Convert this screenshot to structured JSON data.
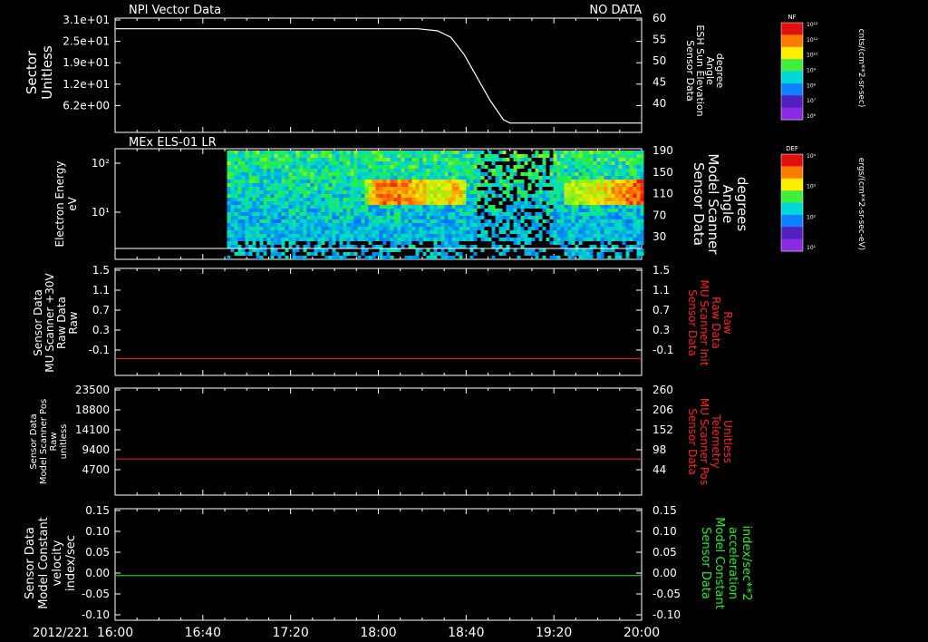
{
  "date_label": "2012/221",
  "time_ticks": [
    "16:00",
    "16:40",
    "17:20",
    "18:00",
    "18:40",
    "19:20",
    "20:00"
  ],
  "colors": {
    "background": "#000000",
    "foreground": "#ffffff",
    "red": "#ff2020",
    "green": "#22ee22"
  },
  "chart_data": [
    {
      "type": "line",
      "title": "NPI Vector Data",
      "status": "NO DATA",
      "ylabel_left": [
        "Sector",
        "Unitless"
      ],
      "yticks_left": [
        "3.1e+01",
        "2.5e+01",
        "1.9e+01",
        "1.2e+01",
        "6.2e+00"
      ],
      "ylabel_right": [
        "Sensor Data",
        "ESH Sun Elevation",
        "Angle",
        "degree"
      ],
      "yticks_right": [
        "60",
        "55",
        "50",
        "45",
        "40"
      ],
      "ylim_right": [
        33,
        60
      ],
      "series": [
        {
          "axis": "right",
          "color": "white",
          "x": [
            16.0,
            18.3,
            18.45,
            18.55,
            18.65,
            18.75,
            18.85,
            18.95,
            19.0,
            20.0
          ],
          "y": [
            57.5,
            57.5,
            57.0,
            55.5,
            51.5,
            46.0,
            40.5,
            36.0,
            35.2,
            35.2
          ]
        }
      ],
      "colorbar": {
        "label": "NF",
        "unit": "cnts/(cm**2-sr-sec)",
        "ticks": [
          "10¹²",
          "10¹¹",
          "10¹⁰",
          "10⁹",
          "10⁸",
          "10⁷",
          "10⁶"
        ]
      }
    },
    {
      "type": "heatmap",
      "title": "MEx ELS-01 LR",
      "ylabel_left": [
        "Electron Energy",
        "eV"
      ],
      "yticks_left": [
        "10²",
        "10¹"
      ],
      "ylabel_right": [
        "Sensor Data",
        "Model Scanner",
        "Angle",
        "degrees"
      ],
      "yticks_right": [
        "190",
        "150",
        "110",
        "70",
        "30"
      ],
      "x_range": [
        16.0,
        20.0
      ],
      "data_start": 16.85,
      "intensity_profile": [
        {
          "x": 16.85,
          "level": 0.45
        },
        {
          "x": 17.8,
          "level": 0.5
        },
        {
          "x": 18.0,
          "level": 0.95
        },
        {
          "x": 18.2,
          "level": 0.9
        },
        {
          "x": 18.4,
          "level": 0.75
        },
        {
          "x": 18.6,
          "level": 0.85
        },
        {
          "x": 18.75,
          "level": 0.3
        },
        {
          "x": 19.3,
          "level": 0.35
        },
        {
          "x": 19.4,
          "level": 0.7
        },
        {
          "x": 19.7,
          "level": 0.8
        },
        {
          "x": 20.0,
          "level": 1.0
        }
      ],
      "colorbar": {
        "label": "DEF",
        "unit": "ergs/(cm**2-sr-sec-eV)",
        "ticks": [
          "10⁴",
          "10³",
          "10²",
          "10¹"
        ]
      }
    },
    {
      "type": "line",
      "ylabel_left": [
        "Sensor Data",
        "MU Scanner +30V",
        "Raw Data",
        "Raw"
      ],
      "yticks_left": [
        "1.5",
        "1.1",
        "0.7",
        "0.3",
        "-0.1"
      ],
      "ylabel_right": [
        "Sensor Data",
        "MU Scanner Init",
        "Raw Data",
        "Raw"
      ],
      "yticks_right": [
        "1.5",
        "1.1",
        "0.7",
        "0.3",
        "-0.1"
      ],
      "ylim": [
        -0.3,
        1.5
      ],
      "series": [
        {
          "color": "red",
          "x": [
            16.0,
            20.0
          ],
          "y": [
            -0.02,
            -0.02
          ]
        }
      ]
    },
    {
      "type": "line",
      "ylabel_left": [
        "Sensor Data",
        "Model Scanner Pos",
        "Raw",
        "unitless"
      ],
      "yticks_left": [
        "23500",
        "18800",
        "14100",
        "9400",
        "4700"
      ],
      "ylabel_right": [
        "Sensor Data",
        "MU Scanner Pos",
        "Telemetry",
        "Unitless"
      ],
      "yticks_right": [
        "260",
        "206",
        "152",
        "98",
        "44"
      ],
      "ylim": [
        0,
        23500
      ],
      "series": [
        {
          "color": "red",
          "x": [
            16.0,
            20.0
          ],
          "y": [
            7950,
            7950
          ]
        }
      ]
    },
    {
      "type": "line",
      "ylabel_left": [
        "Sensor Data",
        "Model Constant",
        "velocity",
        "index/sec"
      ],
      "yticks_left": [
        "0.15",
        "0.10",
        "0.05",
        "0.00",
        "-0.05",
        "-0.10"
      ],
      "ylabel_right": [
        "Sensor Data",
        "Model Constant",
        "acceleration",
        "index/sec**2"
      ],
      "yticks_right": [
        "0.15",
        "0.10",
        "0.05",
        "0.00",
        "-0.05",
        "-0.10"
      ],
      "ylim": [
        -0.1,
        0.15
      ],
      "series": [
        {
          "color": "green",
          "x": [
            16.0,
            20.0
          ],
          "y": [
            0.0,
            0.0
          ]
        }
      ]
    }
  ]
}
